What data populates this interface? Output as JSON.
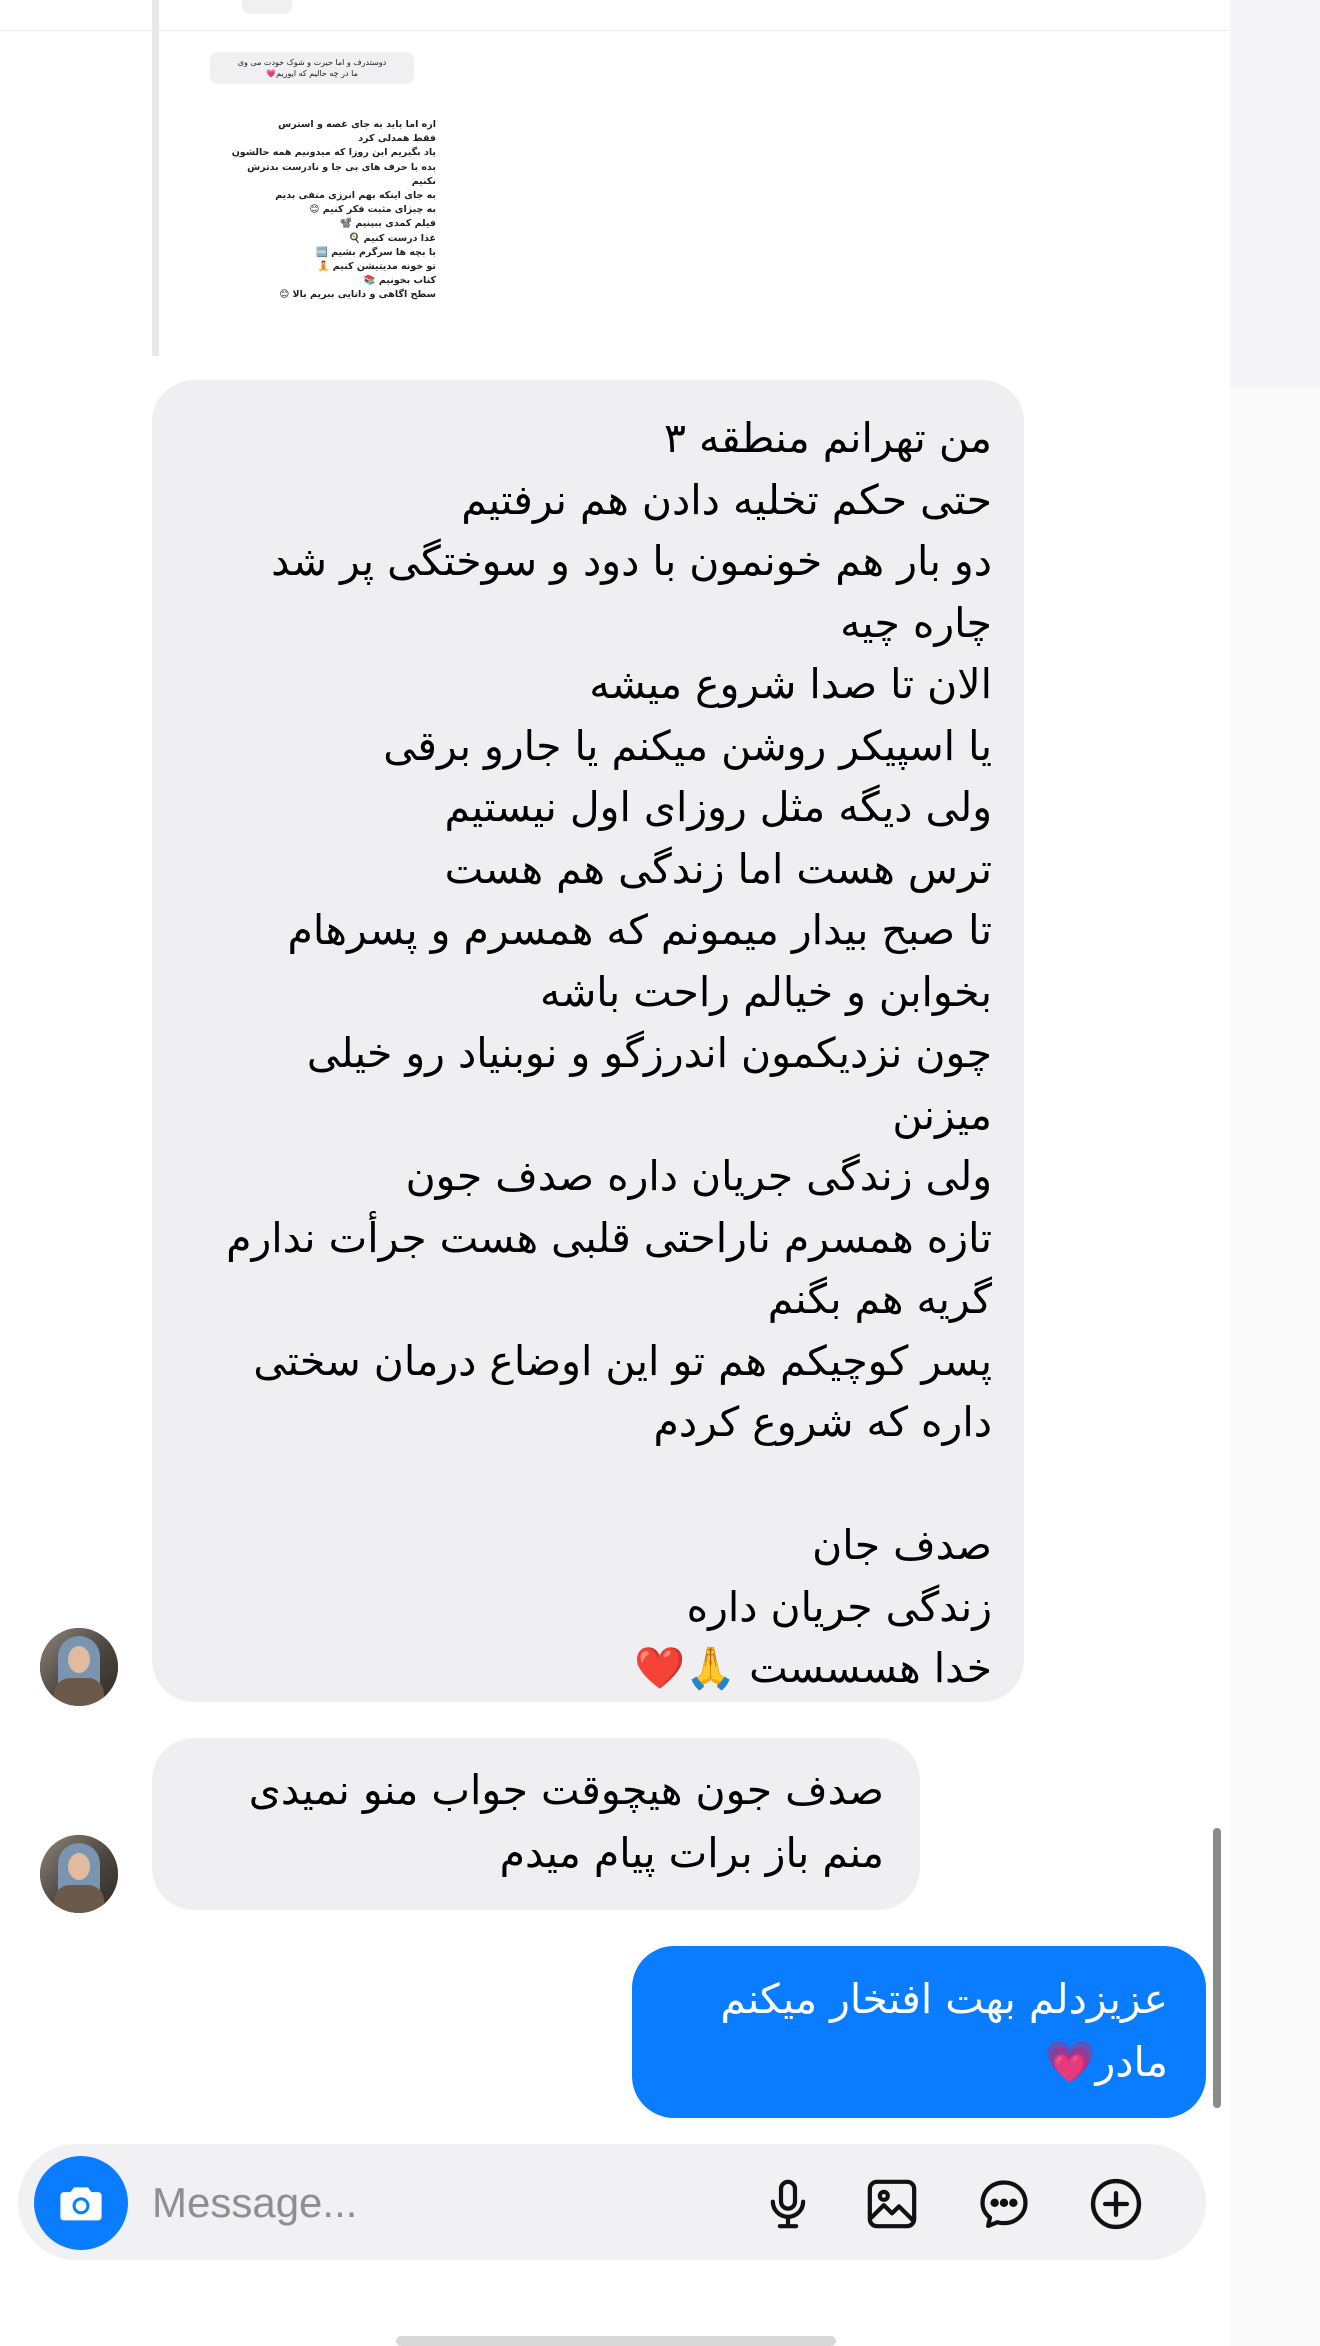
{
  "shared_post": {
    "reply_lines": [
      "دوستدرف و اما حیرت و شوک خودت می وی",
      "ما در چه حالیم که ایوریم💗"
    ],
    "lines": [
      "اره اما باید به جای غصه و استرس",
      "فقط همدلی کرد",
      "یاد بگیریم این روزا که میدونیم همه حالشون",
      "بده با حرف های بی جا و نادرست بدترش",
      "نکنیم",
      "به جای اینکه بهم انرژی منفی بدیم",
      "به چیزای مثبت فکر کنیم 😊",
      "فیلم کمدی ببینیم 📽️",
      "غذا درست کنیم 🍳",
      "با بچه ها سرگرم بشیم 🆒",
      "تو خونه مدیتیشن کنیم 🧘",
      "کتاب بخونیم 📚",
      "سطح اگاهی و دانایی ببریم بالا 😊"
    ]
  },
  "messages": [
    {
      "sender": "incoming",
      "lines": [
        "من تهرانم منطقه ۳",
        "حتی حکم تخلیه دادن هم نرفتیم",
        "دو بار هم خونمون با دود و سوختگی پر شد",
        "چاره چیه",
        "الان تا صدا شروع میشه",
        "یا اسپیکر روشن میکنم یا جارو برقی",
        "ولی دیگه مثل روزای اول نیستیم",
        "ترس هست اما زندگی هم هست",
        "تا صبح بیدار میمونم که همسرم و پسرهام",
        "بخوابن و خیالم راحت باشه",
        "چون نزدیکمون اندرزگو و نوبنیاد رو خیلی",
        "میزنن",
        "ولی زندگی جریان داره صدف جون",
        "تازه همسرم ناراحتی قلبی هست جرأت ندارم",
        "گریه هم بگنم",
        "پسر کوچیکم هم تو این اوضاع درمان سختی",
        "داره که شروع کردم",
        "",
        "صدف جان",
        "زندگی جریان داره",
        "خدا هسسست 🙏❤️"
      ]
    },
    {
      "sender": "incoming",
      "lines": [
        "صدف جون هیچوقت جواب منو نمیدی",
        "منم باز برات پیام میدم"
      ]
    },
    {
      "sender": "outgoing",
      "lines": [
        "عزیزدلم بهت افتخار میکنم",
        "مادر💗"
      ]
    }
  ],
  "composer": {
    "placeholder": "Message...",
    "icons": [
      "camera-icon",
      "microphone-icon",
      "image-icon",
      "sticker-icon",
      "plus-icon"
    ]
  },
  "colors": {
    "outgoing_bubble": "#0a7cff",
    "incoming_bubble": "#efeff1",
    "composer_bg": "#f1f1f3"
  }
}
